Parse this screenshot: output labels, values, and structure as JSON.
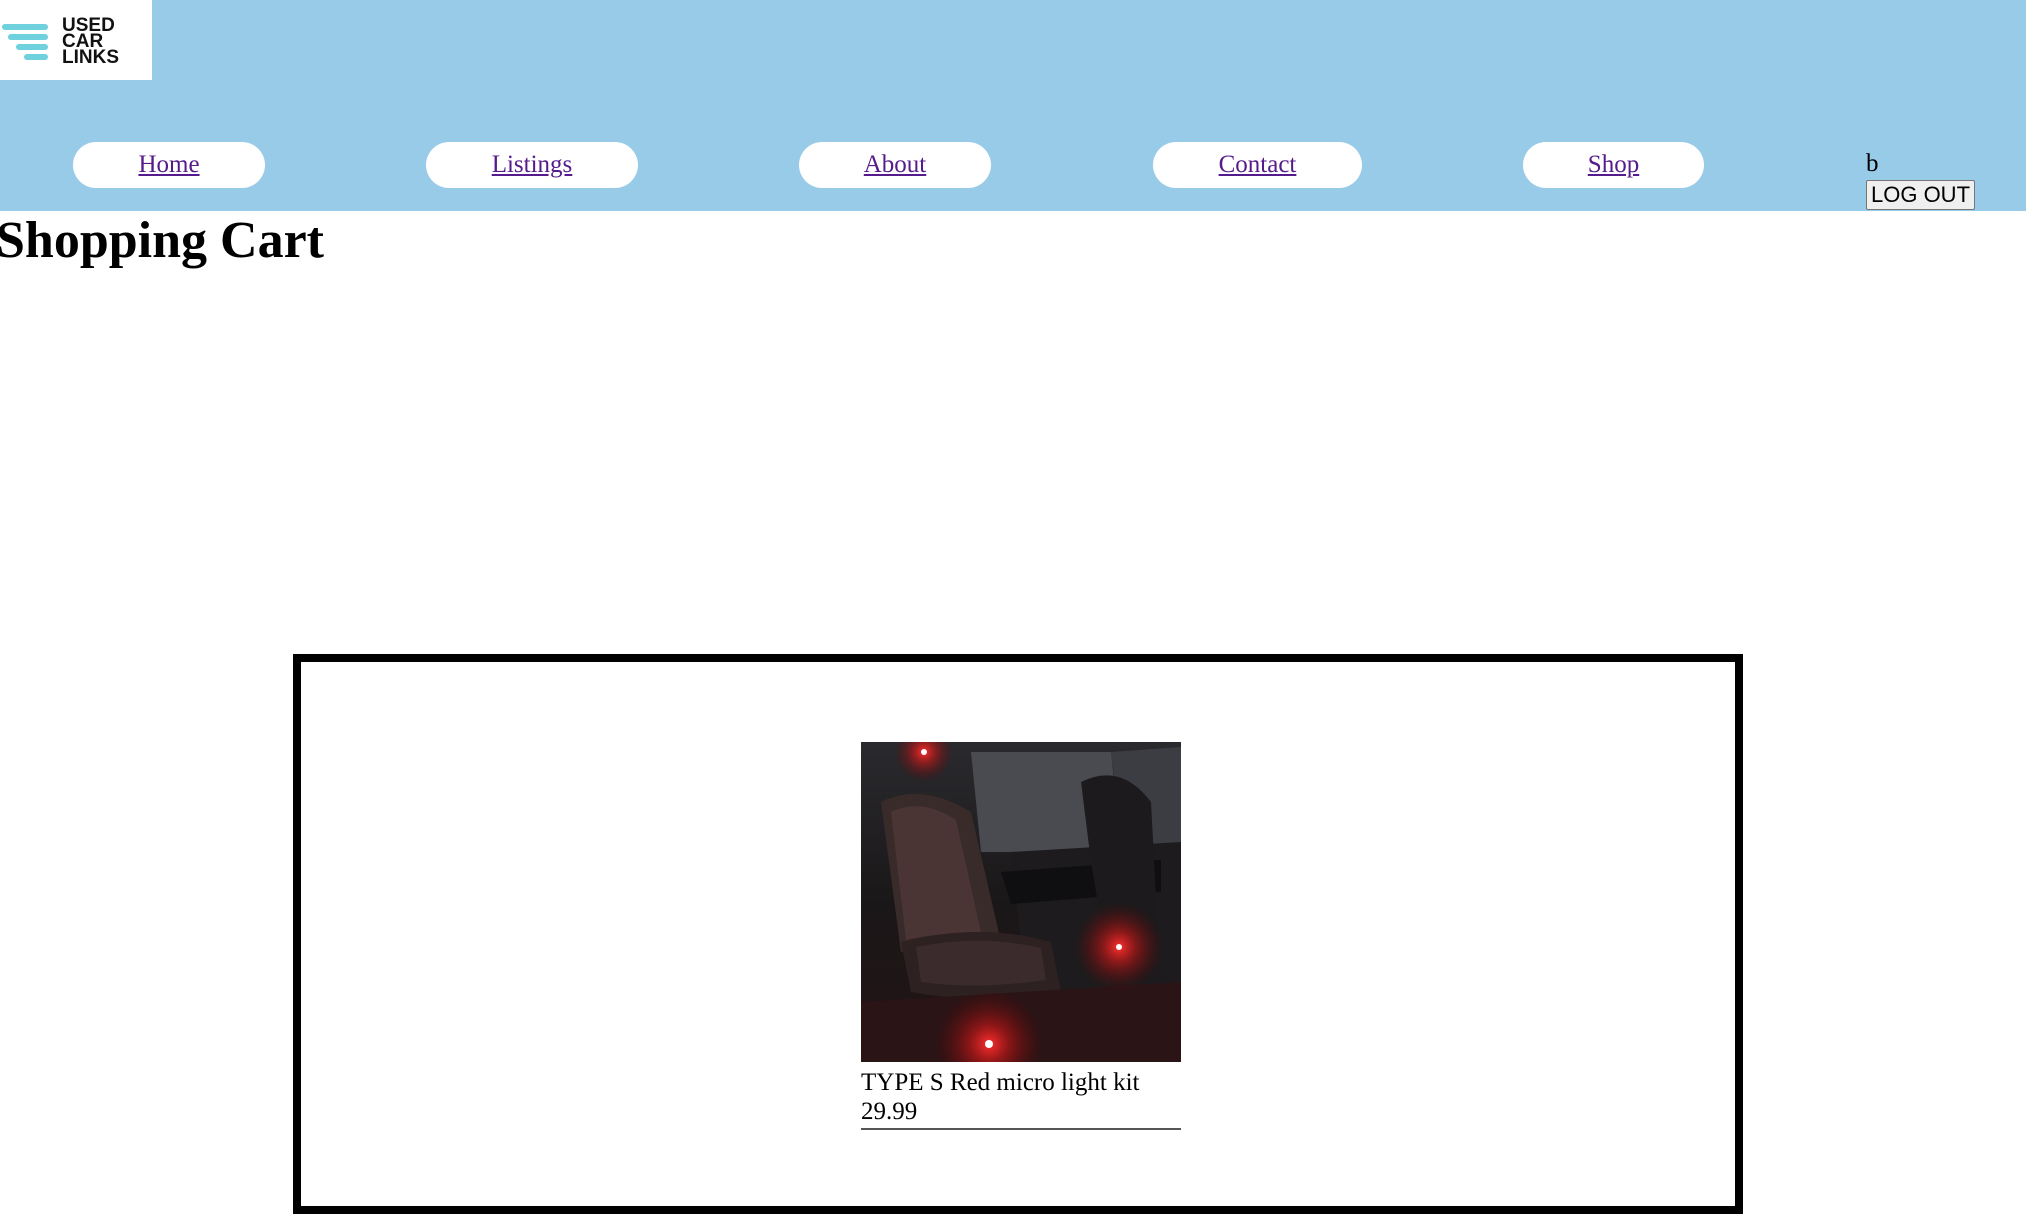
{
  "logo": {
    "text_line1": "USED",
    "text_line2": "CAR",
    "text_line3": "LINKS"
  },
  "nav": {
    "items": [
      {
        "label": "Home"
      },
      {
        "label": "Listings"
      },
      {
        "label": "About"
      },
      {
        "label": "Contact"
      },
      {
        "label": "Shop"
      }
    ]
  },
  "user": {
    "name": "b",
    "logout_label": "LOG OUT"
  },
  "page": {
    "title": "Shopping Cart"
  },
  "cart": {
    "items": [
      {
        "name": "TYPE S Red micro light kit",
        "price": "29.99",
        "image": "car-interior-red-lights"
      }
    ]
  },
  "colors": {
    "header_bg": "#98cbe8",
    "logo_accent": "#6fd0de",
    "link": "#551a8b"
  }
}
